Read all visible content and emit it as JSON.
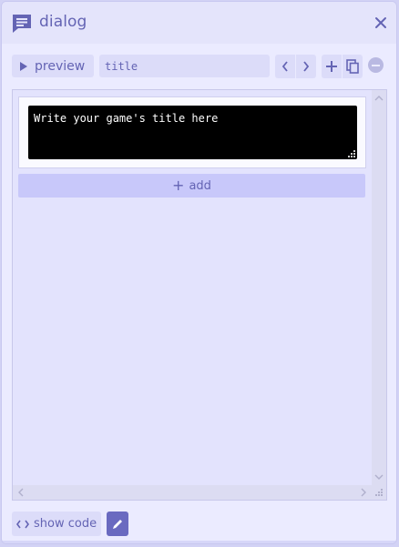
{
  "window": {
    "title": "dialog"
  },
  "toolbar": {
    "preview_label": "preview",
    "title_value": "title"
  },
  "editor": {
    "dialog_text": "Write your game's title here",
    "add_label": "add"
  },
  "footer": {
    "show_code_label": "show code"
  },
  "icons": {
    "header": "dialog-icon",
    "close": "close-icon",
    "preview": "play-icon",
    "prev": "chevron-left-icon",
    "next": "chevron-right-icon",
    "add_page": "plus-icon",
    "copy": "copy-icon",
    "remove": "minus-circle-icon",
    "show_code": "code-icon",
    "edit": "pencil-icon"
  },
  "colors": {
    "accent": "#6464b4",
    "panel_bg": "#ebebff",
    "button_bg": "#dcdcf9",
    "add_button_bg": "#c8c8fa",
    "dialog_bg": "#000000"
  }
}
